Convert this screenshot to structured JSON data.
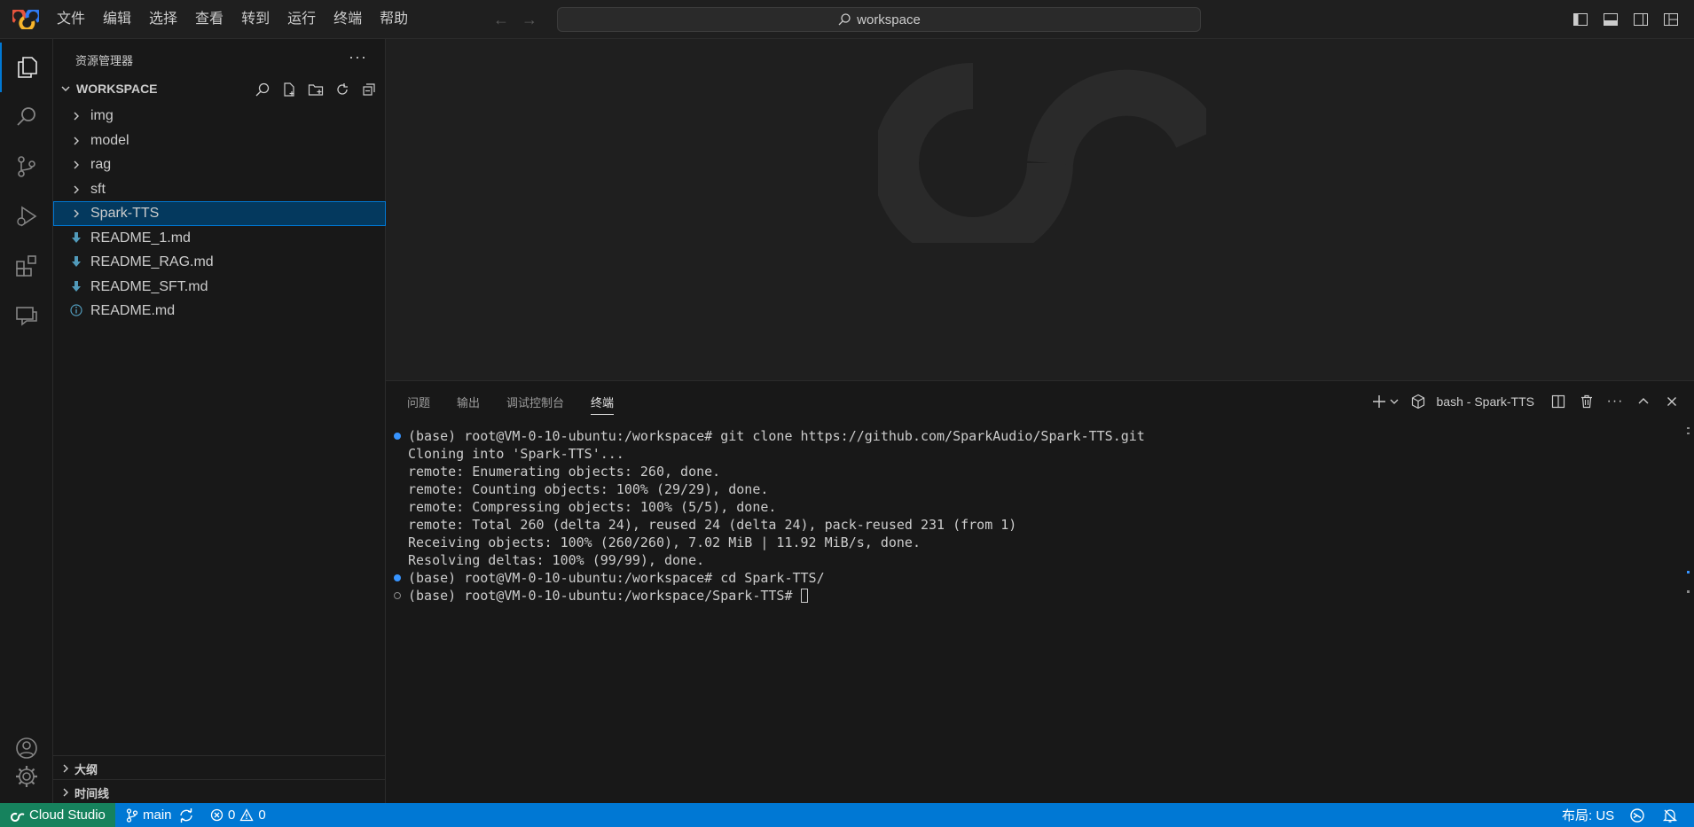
{
  "titlebar": {
    "menu": [
      "文件",
      "编辑",
      "选择",
      "查看",
      "转到",
      "运行",
      "终端",
      "帮助"
    ],
    "search_text": "workspace"
  },
  "sidebar": {
    "title": "资源管理器",
    "workspace_title": "WORKSPACE",
    "tree": [
      {
        "label": "img",
        "type": "folder"
      },
      {
        "label": "model",
        "type": "folder"
      },
      {
        "label": "rag",
        "type": "folder"
      },
      {
        "label": "sft",
        "type": "folder"
      },
      {
        "label": "Spark-TTS",
        "type": "folder",
        "selected": true
      },
      {
        "label": "README_1.md",
        "type": "markdown"
      },
      {
        "label": "README_RAG.md",
        "type": "markdown"
      },
      {
        "label": "README_SFT.md",
        "type": "markdown"
      },
      {
        "label": "README.md",
        "type": "info"
      }
    ],
    "outline": "大纲",
    "timeline": "时间线"
  },
  "panel": {
    "tabs": [
      "问题",
      "输出",
      "调试控制台",
      "终端"
    ],
    "active_tab": "终端",
    "terminal_name": "bash - Spark-TTS",
    "lines": [
      {
        "text": "(base) root@VM-0-10-ubuntu:/workspace# git clone https://github.com/SparkAudio/Spark-TTS.git",
        "marker": "blue"
      },
      {
        "text": "Cloning into 'Spark-TTS'...",
        "marker": "none"
      },
      {
        "text": "remote: Enumerating objects: 260, done.",
        "marker": "none"
      },
      {
        "text": "remote: Counting objects: 100% (29/29), done.",
        "marker": "none"
      },
      {
        "text": "remote: Compressing objects: 100% (5/5), done.",
        "marker": "none"
      },
      {
        "text": "remote: Total 260 (delta 24), reused 24 (delta 24), pack-reused 231 (from 1)",
        "marker": "none"
      },
      {
        "text": "Receiving objects: 100% (260/260), 7.02 MiB | 11.92 MiB/s, done.",
        "marker": "none"
      },
      {
        "text": "Resolving deltas: 100% (99/99), done.",
        "marker": "none"
      },
      {
        "text": "(base) root@VM-0-10-ubuntu:/workspace# cd Spark-TTS/",
        "marker": "blue"
      },
      {
        "text": "(base) root@VM-0-10-ubuntu:/workspace/Spark-TTS# ",
        "marker": "hollow",
        "cursor": true
      }
    ]
  },
  "statusbar": {
    "remote": "Cloud Studio",
    "branch": "main",
    "errors": "0",
    "warnings": "0",
    "layout": "布局: US"
  },
  "colors": {
    "accent": "#0078d4",
    "remote_bg": "#16825d",
    "markdown_icon": "#519aba"
  }
}
